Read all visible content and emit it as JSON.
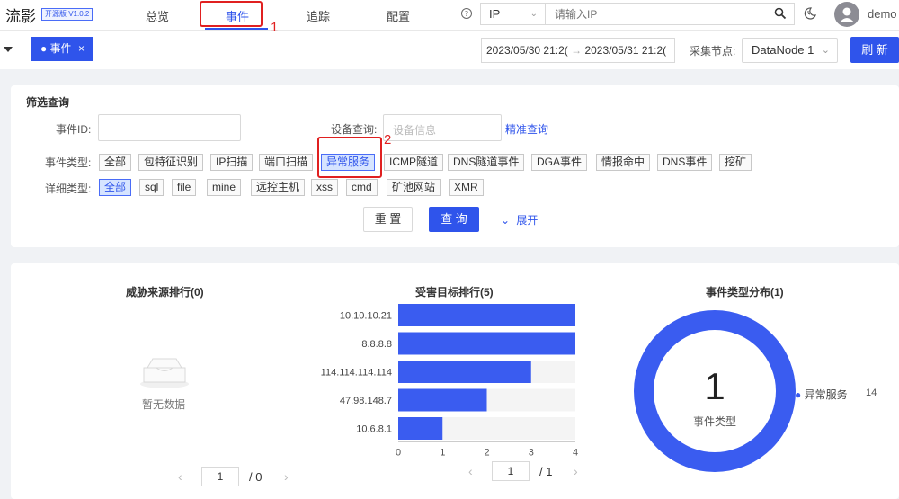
{
  "header": {
    "logo": "流影",
    "version": "开源版 V1.0.2",
    "nav": [
      "总览",
      "事件",
      "追踪",
      "配置"
    ],
    "active_nav": "事件",
    "search_type": "IP",
    "search_placeholder": "请输入IP",
    "username": "demo"
  },
  "annotations": {
    "box1": "1",
    "box2": "2"
  },
  "tabbar": {
    "tab_label": "事件",
    "date_start": "2023/05/30 21:2(",
    "date_end": "2023/05/31 21:2(",
    "node_label": "采集节点:",
    "node_value": "DataNode 1",
    "refresh_label": "刷 新"
  },
  "filter": {
    "title": "筛选查询",
    "event_id_label": "事件ID:",
    "device_label": "设备查询:",
    "device_placeholder": "设备信息",
    "precise_link": "精准查询",
    "event_type_label": "事件类型:",
    "event_types": [
      "全部",
      "包特征识别",
      "IP扫描",
      "端口扫描",
      "异常服务",
      "ICMP隧道",
      "DNS隧道事件",
      "DGA事件",
      "情报命中",
      "DNS事件",
      "挖矿"
    ],
    "event_type_selected": "异常服务",
    "detail_type_label": "详细类型:",
    "detail_types": [
      "全部",
      "sql",
      "file",
      "mine",
      "远控主机",
      "xss",
      "cmd",
      "矿池网站",
      "XMR"
    ],
    "detail_type_selected": "全部",
    "reset_label": "重 置",
    "query_label": "查 询",
    "expand_label": "展开"
  },
  "threat_source": {
    "title": "威胁来源排行(0)",
    "empty_text": "暂无数据",
    "page_current": "1",
    "page_total": "/ 0"
  },
  "victim_target": {
    "title": "受害目标排行(5)",
    "page_current": "1",
    "page_total": "/ 1"
  },
  "event_dist": {
    "title": "事件类型分布(1)",
    "center_value": "1",
    "center_label": "事件类型",
    "legend_label": "异常服务",
    "legend_value": "14"
  },
  "chart_data": [
    {
      "type": "bar",
      "orientation": "horizontal",
      "title": "受害目标排行(5)",
      "categories": [
        "10.10.10.21",
        "8.8.8.8",
        "114.114.114.114",
        "47.98.148.7",
        "10.6.8.1"
      ],
      "values": [
        4,
        4,
        3,
        2,
        1
      ],
      "xlim": [
        0,
        4
      ],
      "xticks": [
        "0",
        "1",
        "2",
        "3",
        "4"
      ],
      "color": "#3a5cf0",
      "track_color": "#f4f4f4"
    },
    {
      "type": "pie",
      "title": "事件类型分布(1)",
      "categories": [
        "异常服务"
      ],
      "values": [
        14
      ],
      "colors": [
        "#3a5cf0"
      ],
      "legend": "right"
    }
  ]
}
